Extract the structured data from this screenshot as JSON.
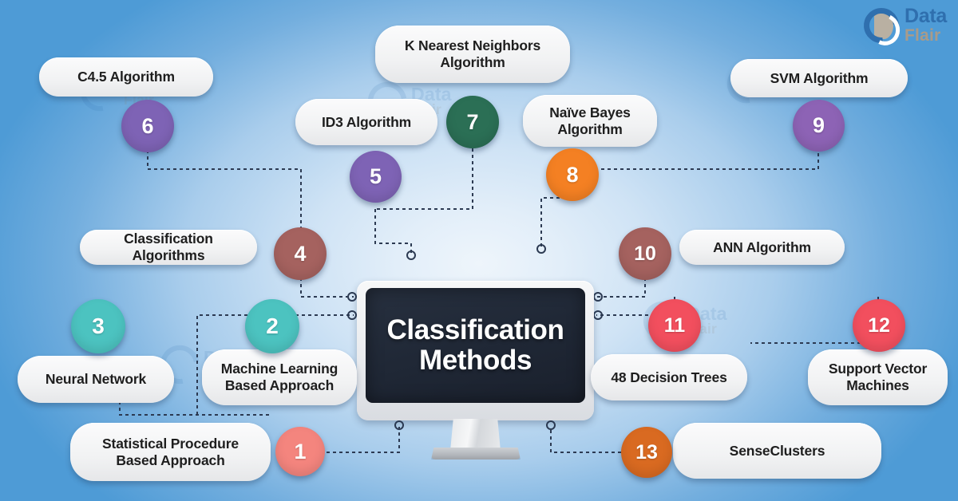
{
  "brand": {
    "name_line1": "Data",
    "name_line2": "Flair",
    "logo_icon": "dataflair-logo-icon"
  },
  "center": {
    "title_line1": "Classification",
    "title_line2": "Methods",
    "device_icon": "desktop-monitor-icon"
  },
  "palette": {
    "background_edge": "#4a97d3",
    "background_center": "#eef5fb",
    "pill_fill": "#f4f5f6",
    "screen_fill": "#1f2735",
    "text_dark": "#1e1e1e"
  },
  "nodes": [
    {
      "number": "1",
      "label": "Statistical Procedure Based Approach",
      "color": "#f4857e"
    },
    {
      "number": "2",
      "label": "Machine Learning Based Approach",
      "color": "#4cc3c0"
    },
    {
      "number": "3",
      "label": "Neural Network",
      "color": "#4cc3c0"
    },
    {
      "number": "4",
      "label": "Classification Algorithms",
      "color": "#a5625f"
    },
    {
      "number": "5",
      "label": "ID3 Algorithm",
      "color": "#7e63b5"
    },
    {
      "number": "6",
      "label": "C4.5 Algorithm",
      "color": "#7e63b5"
    },
    {
      "number": "7",
      "label": "K Nearest Neighbors Algorithm",
      "color": "#2b6f55"
    },
    {
      "number": "8",
      "label": "Naïve Bayes Algorithm",
      "color": "#f48023"
    },
    {
      "number": "9",
      "label": "SVM Algorithm",
      "color": "#8d63b5"
    },
    {
      "number": "10",
      "label": "ANN Algorithm",
      "color": "#a5625f"
    },
    {
      "number": "11",
      "label": "48 Decision Trees",
      "color": "#f24f5e"
    },
    {
      "number": "12",
      "label": "Support Vector Machines",
      "color": "#f24f5e"
    },
    {
      "number": "13",
      "label": "SenseClusters",
      "color": "#d96a21"
    }
  ]
}
